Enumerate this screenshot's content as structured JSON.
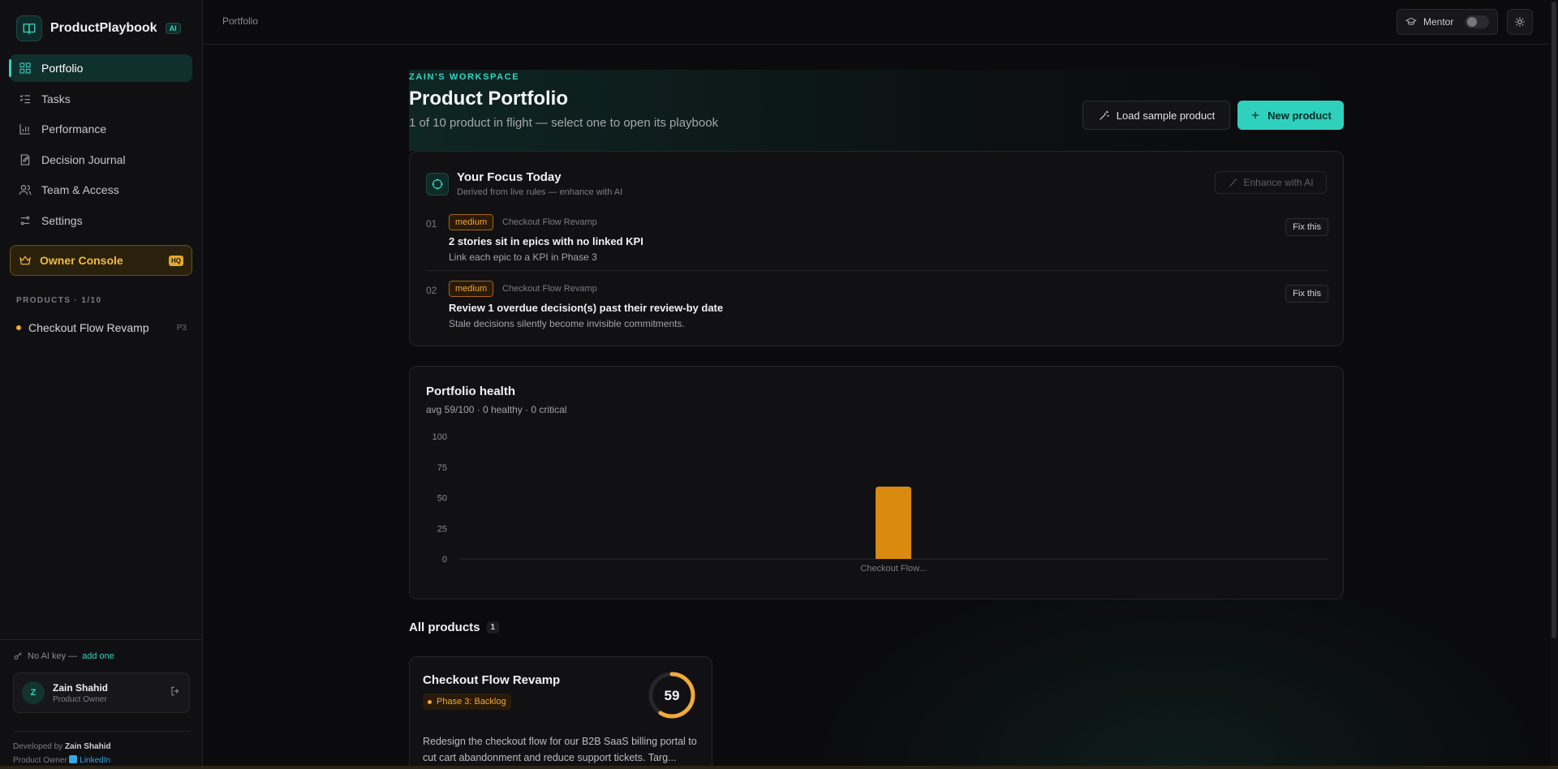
{
  "app": {
    "name": "ProductPlaybook",
    "ai_badge": "AI"
  },
  "sidebar": {
    "nav": [
      {
        "label": "Portfolio",
        "icon": "grid-icon",
        "active": true
      },
      {
        "label": "Tasks",
        "icon": "list-checks-icon"
      },
      {
        "label": "Performance",
        "icon": "bar-chart-icon"
      },
      {
        "label": "Decision Journal",
        "icon": "journal-icon"
      },
      {
        "label": "Team & Access",
        "icon": "users-icon"
      },
      {
        "label": "Settings",
        "icon": "sliders-icon"
      }
    ],
    "owner_console": {
      "label": "Owner Console",
      "badge": "HQ"
    },
    "products_heading": "PRODUCTS · 1/10",
    "products": [
      {
        "name": "Checkout Flow Revamp",
        "phase": "P3"
      }
    ],
    "ai_key": {
      "text": "No AI key —",
      "link": "add one"
    },
    "user": {
      "initial": "Z",
      "name": "Zain Shahid",
      "role": "Product Owner"
    },
    "credit": {
      "prefix": "Developed by",
      "name": "Zain Shahid",
      "role": "Product Owner",
      "link": "LinkedIn"
    }
  },
  "topbar": {
    "breadcrumb": "Portfolio",
    "mentor_label": "Mentor"
  },
  "header": {
    "eyebrow": "ZAIN'S WORKSPACE",
    "title": "Product Portfolio",
    "subtitle": "1 of 10 product in flight — select one to open its playbook",
    "load_sample": "Load sample product",
    "new_product": "New product"
  },
  "focus": {
    "title": "Your Focus Today",
    "subtitle": "Derived from live rules — enhance with AI",
    "enhance": "Enhance with AI",
    "items": [
      {
        "num": "01",
        "severity": "medium",
        "product": "Checkout Flow Revamp",
        "title": "2 stories sit in epics with no linked KPI",
        "desc": "Link each epic to a KPI in Phase 3",
        "action": "Fix this"
      },
      {
        "num": "02",
        "severity": "medium",
        "product": "Checkout Flow Revamp",
        "title": "Review 1 overdue decision(s) past their review-by date",
        "desc": "Stale decisions silently become invisible commitments.",
        "action": "Fix this"
      }
    ]
  },
  "health": {
    "title": "Portfolio health",
    "subtitle": "avg 59/100 · 0 healthy · 0 critical"
  },
  "chart_data": {
    "type": "bar",
    "categories": [
      "Checkout Flow..."
    ],
    "values": [
      59
    ],
    "yticks": [
      0,
      25,
      50,
      75,
      100
    ],
    "ylim": [
      0,
      100
    ],
    "bar_color": "#d98a0f",
    "grid": false
  },
  "all_products": {
    "title": "All products",
    "count": "1",
    "cards": [
      {
        "title": "Checkout Flow Revamp",
        "phase": "Phase 3: Backlog",
        "score": 59,
        "score_label": "59",
        "desc": "Redesign the checkout flow for our B2B SaaS billing portal to cut cart abandonment and reduce support tickets. Targ..."
      }
    ]
  },
  "colors": {
    "accent": "#2fd1bd",
    "warning": "#f2a93b"
  }
}
